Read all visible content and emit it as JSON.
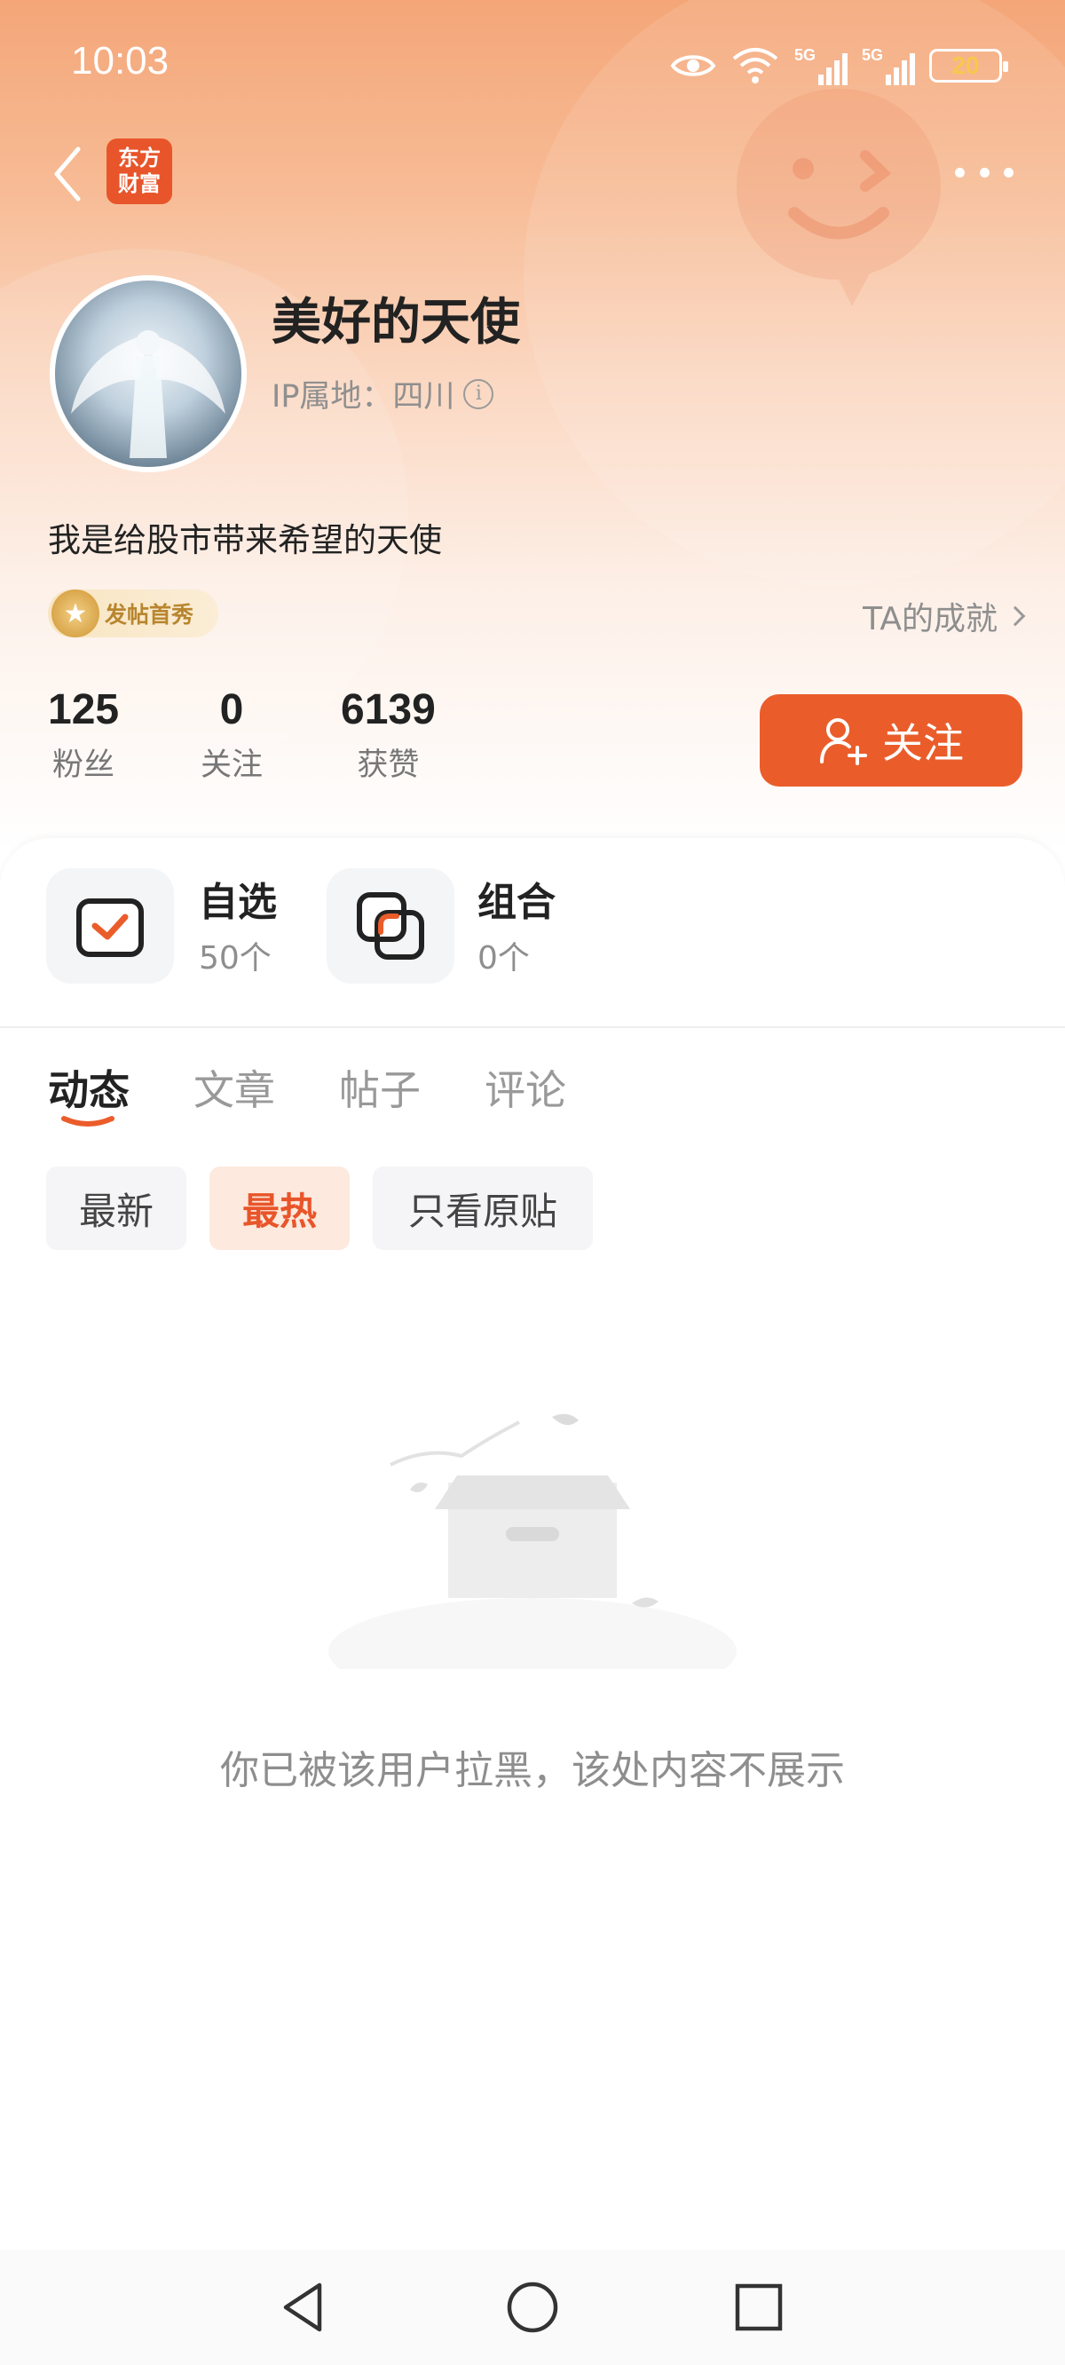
{
  "status_bar": {
    "time": "10:03",
    "battery": "20",
    "network_1": "5G",
    "network_2": "5G"
  },
  "header": {
    "logo_text": "东方财富"
  },
  "profile": {
    "username": "美好的天使",
    "ip_location": "IP属地：四川",
    "bio": "我是给股市带来希望的天使",
    "badge": "发帖首秀",
    "achievements_link": "TA的成就"
  },
  "stats": [
    {
      "value": "125",
      "label": "粉丝"
    },
    {
      "value": "0",
      "label": "关注"
    },
    {
      "value": "6139",
      "label": "获赞"
    }
  ],
  "follow_button": "关注",
  "tools": [
    {
      "title": "自选",
      "count": "50个"
    },
    {
      "title": "组合",
      "count": "0个"
    }
  ],
  "tabs": [
    "动态",
    "文章",
    "帖子",
    "评论"
  ],
  "filters": [
    "最新",
    "最热",
    "只看原贴"
  ],
  "empty_message": "你已被该用户拉黑，该处内容不展示",
  "colors": {
    "accent": "#ea5d2b",
    "header_top": "#f4a678"
  }
}
